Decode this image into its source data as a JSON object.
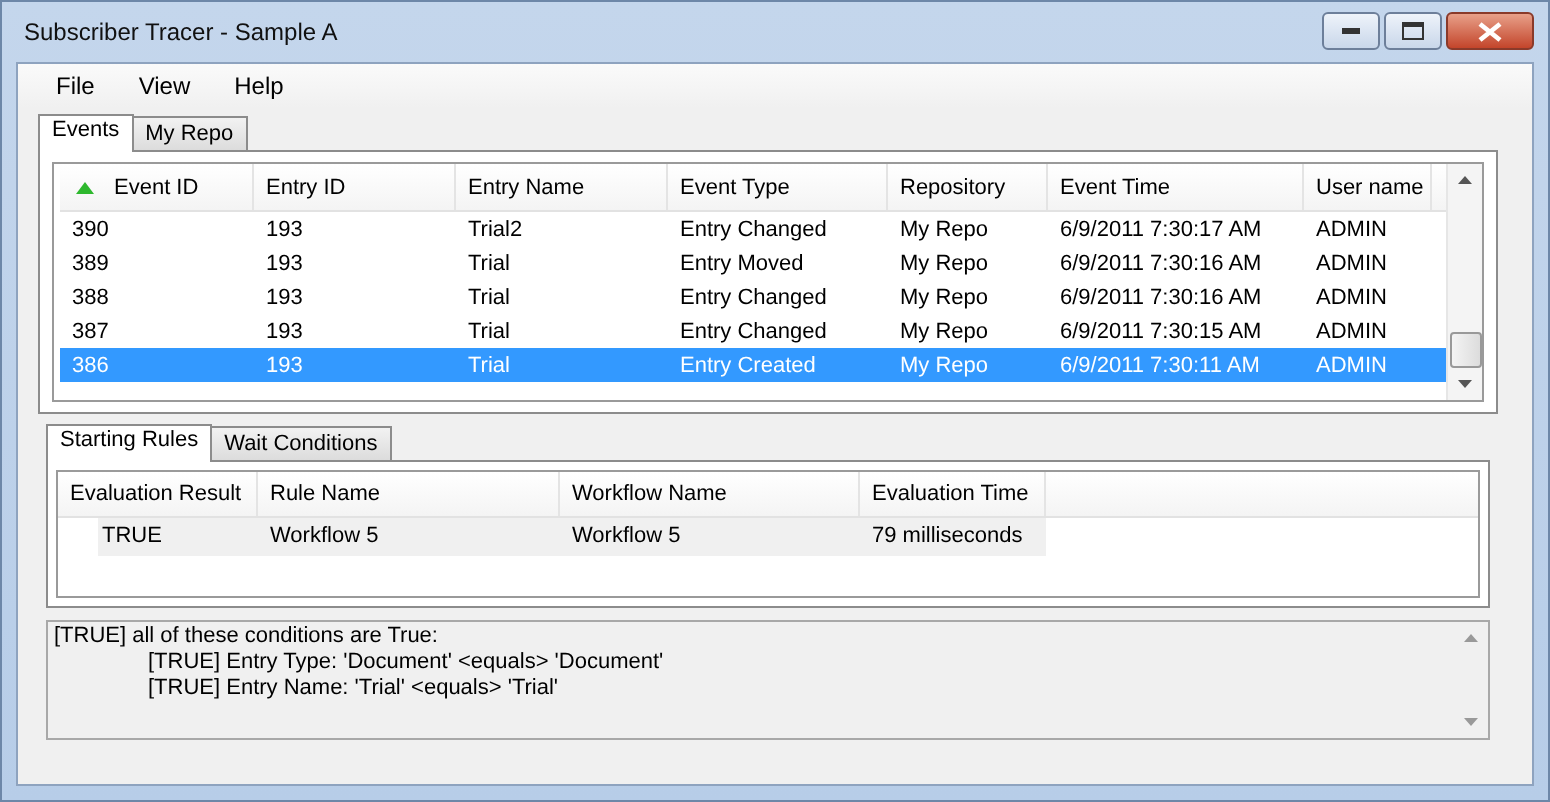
{
  "window": {
    "title": "Subscriber Tracer - Sample A"
  },
  "menu": [
    "File",
    "View",
    "Help"
  ],
  "tabs": [
    {
      "label": "Events",
      "selected": true
    },
    {
      "label": "My Repo",
      "selected": false
    }
  ],
  "events": {
    "columns": [
      {
        "label": "Event ID",
        "sorted": true
      },
      {
        "label": "Entry ID",
        "sorted": false
      },
      {
        "label": "Entry Name",
        "sorted": false
      },
      {
        "label": "Event Type",
        "sorted": false
      },
      {
        "label": "Repository",
        "sorted": false
      },
      {
        "label": "Event Time",
        "sorted": false
      },
      {
        "label": "User name",
        "sorted": false
      }
    ],
    "rows": [
      {
        "cells": [
          "390",
          "193",
          "Trial2",
          "Entry Changed",
          "My Repo",
          "6/9/2011 7:30:17 AM",
          "ADMIN"
        ],
        "selected": false
      },
      {
        "cells": [
          "389",
          "193",
          "Trial",
          "Entry Moved",
          "My Repo",
          "6/9/2011 7:30:16 AM",
          "ADMIN"
        ],
        "selected": false
      },
      {
        "cells": [
          "388",
          "193",
          "Trial",
          "Entry Changed",
          "My Repo",
          "6/9/2011 7:30:16 AM",
          "ADMIN"
        ],
        "selected": false
      },
      {
        "cells": [
          "387",
          "193",
          "Trial",
          "Entry Changed",
          "My Repo",
          "6/9/2011 7:30:15 AM",
          "ADMIN"
        ],
        "selected": false
      },
      {
        "cells": [
          "386",
          "193",
          "Trial",
          "Entry Created",
          "My Repo",
          "6/9/2011 7:30:11 AM",
          "ADMIN"
        ],
        "selected": true
      }
    ]
  },
  "sub_tabs": [
    {
      "label": "Starting Rules",
      "selected": true
    },
    {
      "label": "Wait Conditions",
      "selected": false
    }
  ],
  "rules": {
    "columns": [
      "Evaluation Result",
      "Rule Name",
      "Workflow Name",
      "Evaluation Time"
    ],
    "rows": [
      [
        "TRUE",
        "Workflow 5",
        "Workflow 5",
        "79 milliseconds"
      ]
    ]
  },
  "details": [
    {
      "text": "[TRUE] all of these conditions are True:",
      "children": [
        {
          "text": "[TRUE] Entry Type: 'Document' <equals> 'Document'"
        },
        {
          "text": "[TRUE] Entry Name: 'Trial' <equals> 'Trial'"
        }
      ]
    }
  ]
}
